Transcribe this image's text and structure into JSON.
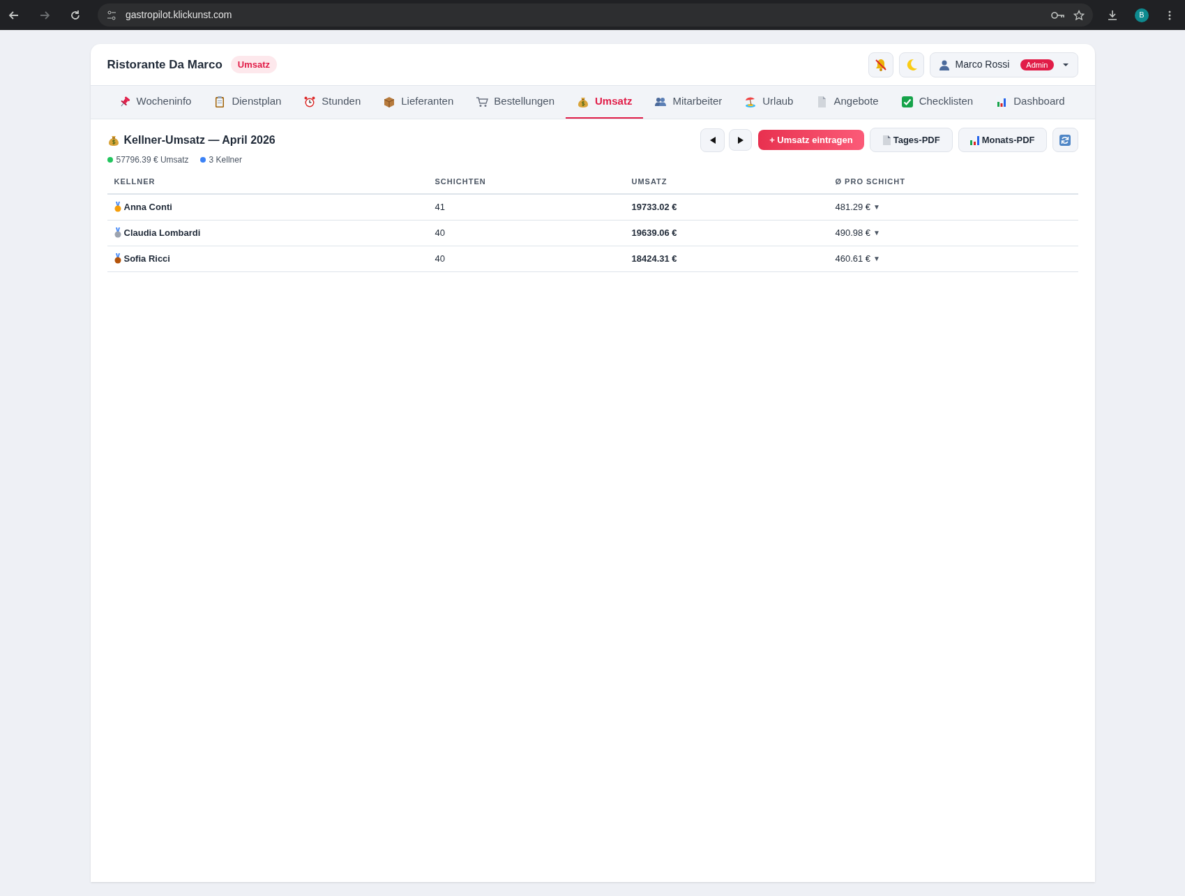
{
  "browser": {
    "url": "gastropilot.klickunst.com",
    "profile": "B"
  },
  "header": {
    "title": "Ristorante Da Marco",
    "badge": "Umsatz",
    "user": "Marco Rossi",
    "role": "Admin"
  },
  "tabs": [
    {
      "label": "Wocheninfo",
      "selected": false
    },
    {
      "label": "Dienstplan",
      "selected": false
    },
    {
      "label": "Stunden",
      "selected": false
    },
    {
      "label": "Lieferanten",
      "selected": false
    },
    {
      "label": "Bestellungen",
      "selected": false
    },
    {
      "label": "Umsatz",
      "selected": true
    },
    {
      "label": "Mitarbeiter",
      "selected": false
    },
    {
      "label": "Urlaub",
      "selected": false
    },
    {
      "label": "Angebote",
      "selected": false
    },
    {
      "label": "Checklisten",
      "selected": false
    },
    {
      "label": "Dashboard",
      "selected": false
    }
  ],
  "section": {
    "title": "Kellner-Umsatz — April 2026",
    "stats": [
      {
        "text": "57796.39 € Umsatz",
        "color": "#22c55e"
      },
      {
        "text": "3 Kellner",
        "color": "#3b82f6"
      }
    ],
    "buttons": {
      "add": "+ Umsatz eintragen",
      "daily": "Tages-PDF",
      "monthly": "Monats-PDF"
    }
  },
  "table": {
    "columns": [
      "KELLNER",
      "SCHICHTEN",
      "UMSATZ",
      "Ø PRO SCHICHT"
    ],
    "rows": [
      {
        "name": "Anna Conti",
        "shifts": "41",
        "revenue": "19733.02 €",
        "per_shift": "481.29 €",
        "trend": "▼"
      },
      {
        "name": "Claudia Lombardi",
        "shifts": "40",
        "revenue": "19639.06 €",
        "per_shift": "490.98 €",
        "trend": "▼"
      },
      {
        "name": "Sofia Ricci",
        "shifts": "40",
        "revenue": "18424.31 €",
        "per_shift": "460.61 €",
        "trend": "▼"
      }
    ]
  }
}
